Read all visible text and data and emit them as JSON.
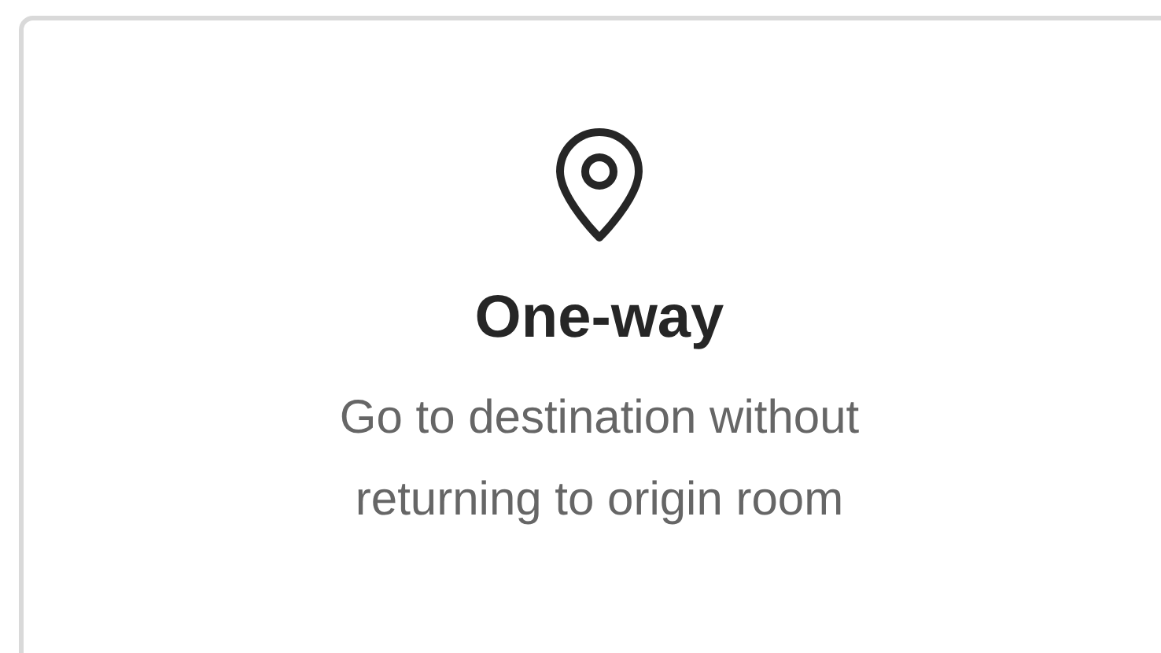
{
  "option": {
    "title": "One-way",
    "description": "Go to destination without returning to origin room"
  }
}
